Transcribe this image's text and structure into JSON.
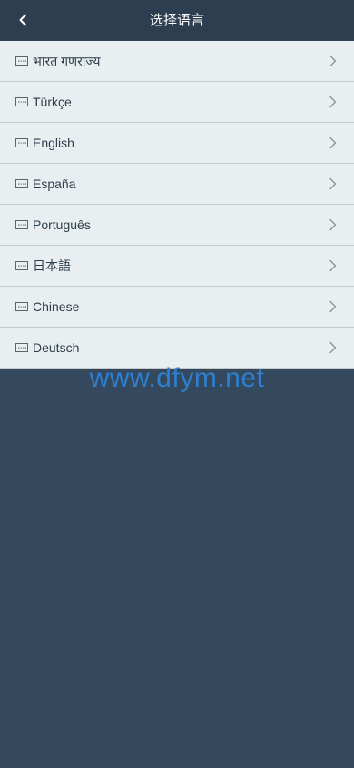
{
  "header": {
    "title": "选择语言",
    "back_icon": "chevron-left-icon"
  },
  "languages": [
    {
      "label": "भारत गणराज्य",
      "icon": "keyboard-icon"
    },
    {
      "label": "Türkçe",
      "icon": "keyboard-icon"
    },
    {
      "label": "English",
      "icon": "keyboard-icon"
    },
    {
      "label": "España",
      "icon": "keyboard-icon"
    },
    {
      "label": "Português",
      "icon": "keyboard-icon"
    },
    {
      "label": "日本語",
      "icon": "keyboard-icon"
    },
    {
      "label": "Chinese",
      "icon": "keyboard-icon"
    },
    {
      "label": "Deutsch",
      "icon": "keyboard-icon"
    }
  ],
  "watermark": "www.dfym.net",
  "colors": {
    "header_bg": "#2c3e50",
    "page_bg": "#35495e",
    "list_bg": "#e9eef0",
    "watermark": "#2d7fd0"
  }
}
